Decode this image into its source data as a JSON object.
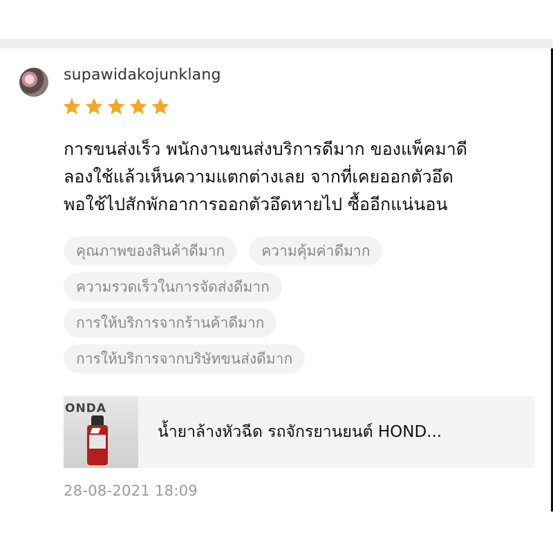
{
  "review": {
    "username": "supawidakojunklang",
    "rating": 5,
    "rating_max": 5,
    "star_color": "#f6a623",
    "text_lines": [
      "การขนส่งเร็ว พนักงานขนส่งบริการดีมาก ของแพ็คมาดี",
      "ลองใช้แล้วเห็นความแตกต่างเลย จากที่เคยออกตัวอึด",
      "พอใช้ไปสักพักอาการออกตัวอึดหายไป ซื้ออีกแน่นอน"
    ],
    "tags": [
      "คุณภาพของสินค้าดีมาก",
      "ความคุ้มค่าดีมาก",
      "ความรวดเร็วในการจัดส่งดีมาก",
      "การให้บริการจากร้านค้าดีมาก",
      "การให้บริการจากบริษัทขนส่งดีมาก"
    ],
    "product": {
      "title": "น้ำยาล้างหัวฉีด  รถจักรยานยนต์ HOND...",
      "thumb_sign": "ONDA"
    },
    "date": "28-08-2021 18:09"
  }
}
